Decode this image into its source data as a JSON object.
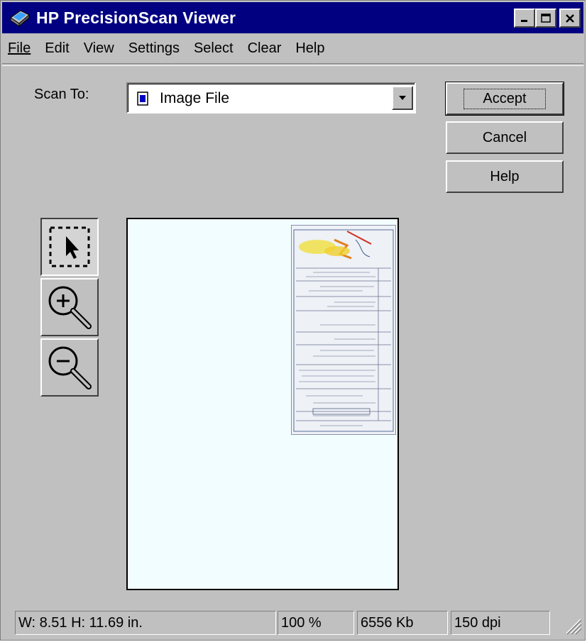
{
  "window": {
    "title": "HP PrecisionScan Viewer"
  },
  "menu": [
    "File",
    "Edit",
    "View",
    "Settings",
    "Select",
    "Clear",
    "Help"
  ],
  "scan_to": {
    "label": "Scan To:",
    "value": "Image File"
  },
  "buttons": {
    "accept": "Accept",
    "cancel": "Cancel",
    "help": "Help"
  },
  "tools": [
    {
      "name": "select-tool",
      "icon": "arrow-select-icon",
      "active": true
    },
    {
      "name": "zoom-in-tool",
      "icon": "zoom-in-icon",
      "active": false
    },
    {
      "name": "zoom-out-tool",
      "icon": "zoom-out-icon",
      "active": false
    }
  ],
  "status": {
    "dimensions": "W: 8.51    H: 11.69  in.",
    "zoom": "100 %",
    "size": "6556 Kb",
    "resolution": "150 dpi"
  },
  "colors": {
    "titlebar": "#000080",
    "face": "#c0c0c0",
    "preview_bg": "#f2fdff"
  }
}
